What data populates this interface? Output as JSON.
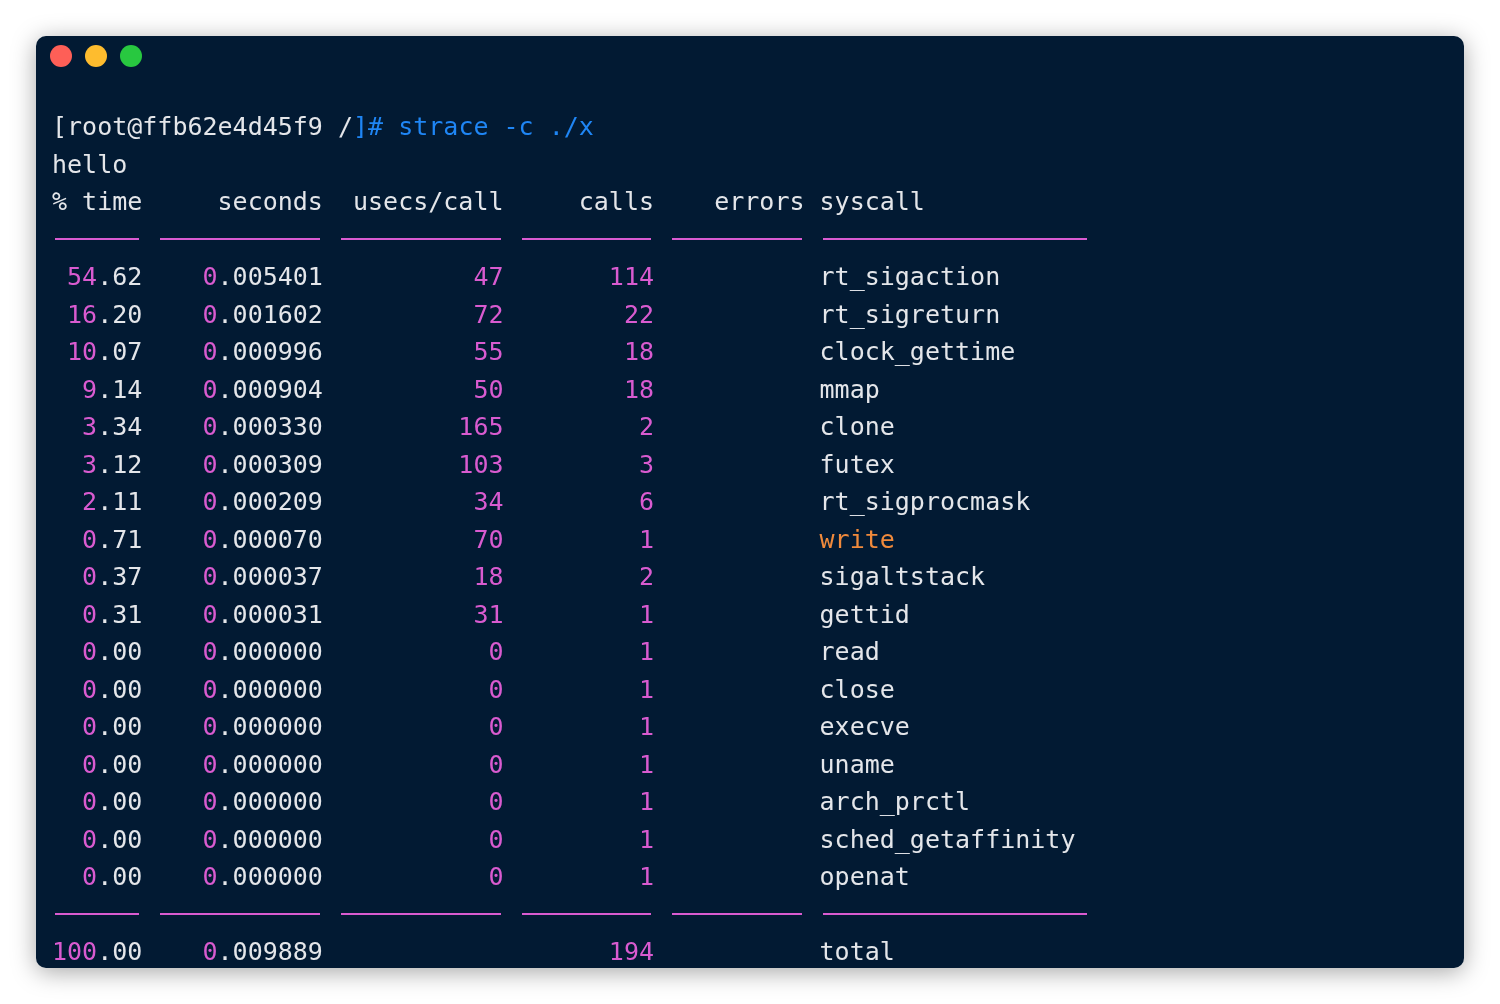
{
  "window": {
    "controls": [
      {
        "kind": "close"
      },
      {
        "kind": "minimize"
      },
      {
        "kind": "zoom"
      }
    ]
  },
  "command_line": [
    {
      "kind": "prompt",
      "text": "[root@ffb62e4d45f9 /"
    },
    {
      "kind": "command",
      "text": "]# strace -c ./x"
    }
  ],
  "output": "hello",
  "table": {
    "columns": [
      "% time",
      "seconds",
      "usecs/call",
      "calls",
      "errors",
      "syscall"
    ],
    "rows": [
      {
        "time": "54.62",
        "seconds": "0.005401",
        "usecs_call": "47",
        "calls": "114",
        "syscall": "rt_sigaction",
        "highlight": false
      },
      {
        "time": "16.20",
        "seconds": "0.001602",
        "usecs_call": "72",
        "calls": "22",
        "syscall": "rt_sigreturn",
        "highlight": false
      },
      {
        "time": "10.07",
        "seconds": "0.000996",
        "usecs_call": "55",
        "calls": "18",
        "syscall": "clock_gettime",
        "highlight": false
      },
      {
        "time": "9.14",
        "seconds": "0.000904",
        "usecs_call": "50",
        "calls": "18",
        "syscall": "mmap",
        "highlight": false
      },
      {
        "time": "3.34",
        "seconds": "0.000330",
        "usecs_call": "165",
        "calls": "2",
        "syscall": "clone",
        "highlight": false
      },
      {
        "time": "3.12",
        "seconds": "0.000309",
        "usecs_call": "103",
        "calls": "3",
        "syscall": "futex",
        "highlight": false
      },
      {
        "time": "2.11",
        "seconds": "0.000209",
        "usecs_call": "34",
        "calls": "6",
        "syscall": "rt_sigprocmask",
        "highlight": false
      },
      {
        "time": "0.71",
        "seconds": "0.000070",
        "usecs_call": "70",
        "calls": "1",
        "syscall": "write",
        "highlight": true
      },
      {
        "time": "0.37",
        "seconds": "0.000037",
        "usecs_call": "18",
        "calls": "2",
        "syscall": "sigaltstack",
        "highlight": false
      },
      {
        "time": "0.31",
        "seconds": "0.000031",
        "usecs_call": "31",
        "calls": "1",
        "syscall": "gettid",
        "highlight": false
      },
      {
        "time": "0.00",
        "seconds": "0.000000",
        "usecs_call": "0",
        "calls": "1",
        "syscall": "read",
        "highlight": false
      },
      {
        "time": "0.00",
        "seconds": "0.000000",
        "usecs_call": "0",
        "calls": "1",
        "syscall": "close",
        "highlight": false
      },
      {
        "time": "0.00",
        "seconds": "0.000000",
        "usecs_call": "0",
        "calls": "1",
        "syscall": "execve",
        "highlight": false
      },
      {
        "time": "0.00",
        "seconds": "0.000000",
        "usecs_call": "0",
        "calls": "1",
        "syscall": "uname",
        "highlight": false
      },
      {
        "time": "0.00",
        "seconds": "0.000000",
        "usecs_call": "0",
        "calls": "1",
        "syscall": "arch_prctl",
        "highlight": false
      },
      {
        "time": "0.00",
        "seconds": "0.000000",
        "usecs_call": "0",
        "calls": "1",
        "syscall": "sched_getaffinity",
        "highlight": false
      },
      {
        "time": "0.00",
        "seconds": "0.000000",
        "usecs_call": "0",
        "calls": "1",
        "syscall": "openat",
        "highlight": false
      }
    ],
    "total": {
      "time": "100.00",
      "seconds": "0.009889",
      "calls": "194",
      "syscall": "total"
    }
  }
}
